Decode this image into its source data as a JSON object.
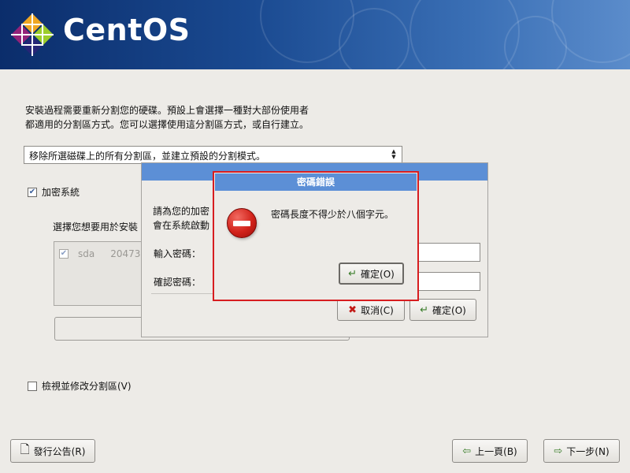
{
  "header": {
    "brand": "CentOS"
  },
  "intro": {
    "line1": "安裝過程需要重新分割您的硬碟。預設上會選擇一種對大部份使用者",
    "line2": "都適用的分割區方式。您可以選擇使用這分割區方式，或自行建立。"
  },
  "partition_select": {
    "value": "移除所選磁碟上的所有分割區，並建立預設的分割模式。"
  },
  "encrypt": {
    "label": "加密系統",
    "checked": true
  },
  "drives": {
    "label": "選擇您想要用於安裝",
    "items": [
      {
        "name": "sda",
        "size": "20473"
      }
    ]
  },
  "review": {
    "label": "檢視並修改分割區(V)",
    "checked": false
  },
  "passphrase_dialog": {
    "text_line1": "請為您的加密",
    "text_line2": "會在系統啟動",
    "enter_label": "輸入密碼：",
    "confirm_label": "確認密碼：",
    "cancel_label": "取消(C)",
    "ok_label": "確定(O)"
  },
  "error_dialog": {
    "title": "密碼錯誤",
    "message": "密碼長度不得少於八個字元。",
    "ok_label": "確定(O)"
  },
  "footer": {
    "release_notes_label": "發行公告(R)",
    "back_label": "上一頁(B)",
    "next_label": "下一步(N)"
  }
}
